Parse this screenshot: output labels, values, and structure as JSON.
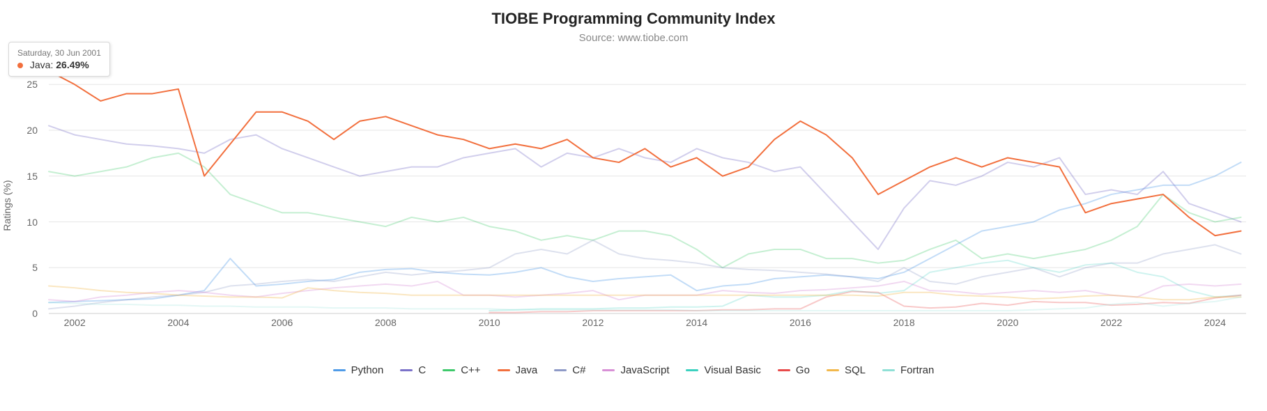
{
  "chart_data": {
    "type": "line",
    "title": "TIOBE Programming Community Index",
    "subtitle": "Source: www.tiobe.com",
    "ylabel": "Ratings (%)",
    "xlabel": "",
    "xlim": [
      2001.5,
      2024.6
    ],
    "ylim": [
      0,
      27
    ],
    "yticks": [
      0,
      5,
      10,
      15,
      20,
      25
    ],
    "xticks": [
      2002,
      2004,
      2006,
      2008,
      2010,
      2012,
      2014,
      2016,
      2018,
      2020,
      2022,
      2024
    ],
    "x": [
      2001.5,
      2002,
      2002.5,
      2003,
      2003.5,
      2004,
      2004.5,
      2005,
      2005.5,
      2006,
      2006.5,
      2007,
      2007.5,
      2008,
      2008.5,
      2009,
      2009.5,
      2010,
      2010.5,
      2011,
      2011.5,
      2012,
      2012.5,
      2013,
      2013.5,
      2014,
      2014.5,
      2015,
      2015.5,
      2016,
      2016.5,
      2017,
      2017.5,
      2018,
      2018.5,
      2019,
      2019.5,
      2020,
      2020.5,
      2021,
      2021.5,
      2022,
      2022.5,
      2023,
      2023.5,
      2024,
      2024.5
    ],
    "series": [
      {
        "name": "Python",
        "color": "#4F9BE8",
        "provisional_opacity": 0.35,
        "values": [
          1.2,
          1.3,
          1.4,
          1.5,
          1.6,
          2.0,
          2.5,
          6.0,
          3.0,
          3.2,
          3.5,
          3.7,
          4.5,
          4.8,
          4.9,
          4.5,
          4.3,
          4.2,
          4.5,
          5.0,
          4.0,
          3.5,
          3.8,
          4.0,
          4.2,
          2.5,
          3.0,
          3.2,
          3.8,
          4.0,
          4.2,
          4.0,
          3.8,
          4.5,
          6.0,
          7.5,
          9.0,
          9.5,
          10.0,
          11.3,
          12.0,
          13.0,
          13.5,
          14.0,
          14.0,
          15.0,
          16.5
        ]
      },
      {
        "name": "C",
        "color": "#7B72C9",
        "provisional_opacity": 0.35,
        "values": [
          20.5,
          19.5,
          19.0,
          18.5,
          18.3,
          18.0,
          17.5,
          19.0,
          19.5,
          18.0,
          17.0,
          16.0,
          15.0,
          15.5,
          16.0,
          16.0,
          17.0,
          17.5,
          18.0,
          16.0,
          17.5,
          17.0,
          18.0,
          17.0,
          16.5,
          18.0,
          17.0,
          16.5,
          15.5,
          16.0,
          13.0,
          10.0,
          7.0,
          11.5,
          14.5,
          14.0,
          15.0,
          16.5,
          16.0,
          17.0,
          13.0,
          13.5,
          13.0,
          15.5,
          12.0,
          11.0,
          10.0
        ]
      },
      {
        "name": "C++",
        "color": "#3EC96B",
        "provisional_opacity": 0.3,
        "values": [
          15.5,
          15.0,
          15.5,
          16.0,
          17.0,
          17.5,
          16.0,
          13.0,
          12.0,
          11.0,
          11.0,
          10.5,
          10.0,
          9.5,
          10.5,
          10.0,
          10.5,
          9.5,
          9.0,
          8.0,
          8.5,
          8.0,
          9.0,
          9.0,
          8.5,
          7.0,
          5.0,
          6.5,
          7.0,
          7.0,
          6.0,
          6.0,
          5.5,
          5.8,
          7.0,
          8.0,
          6.0,
          6.5,
          6.0,
          6.5,
          7.0,
          8.0,
          9.5,
          13.0,
          11.0,
          10.0,
          10.5
        ]
      },
      {
        "name": "Java",
        "color": "#F26F3D",
        "provisional_opacity": 1.0,
        "values": [
          26.49,
          25.0,
          23.2,
          24.0,
          24.0,
          24.5,
          15.0,
          18.5,
          22.0,
          22.0,
          21.0,
          19.0,
          21.0,
          21.5,
          20.5,
          19.5,
          19.0,
          18.0,
          18.5,
          18.0,
          19.0,
          17.0,
          16.5,
          18.0,
          16.0,
          17.0,
          15.0,
          16.0,
          19.0,
          21.0,
          19.5,
          17.0,
          13.0,
          14.5,
          16.0,
          17.0,
          16.0,
          17.0,
          16.5,
          16.0,
          11.0,
          12.0,
          12.5,
          13.0,
          10.5,
          8.5,
          9.0
        ]
      },
      {
        "name": "C#",
        "color": "#8E9AC7",
        "provisional_opacity": 0.3,
        "values": [
          0.5,
          0.8,
          1.2,
          1.5,
          1.8,
          2.0,
          2.3,
          3.0,
          3.2,
          3.5,
          3.7,
          3.5,
          4.0,
          4.5,
          4.2,
          4.5,
          4.7,
          5.0,
          6.5,
          7.0,
          6.5,
          8.0,
          6.5,
          6.0,
          5.8,
          5.5,
          5.0,
          4.8,
          4.7,
          4.5,
          4.3,
          4.0,
          3.5,
          5.0,
          3.5,
          3.2,
          4.0,
          4.5,
          5.0,
          4.0,
          5.0,
          5.5,
          5.5,
          6.5,
          7.0,
          7.5,
          6.5
        ]
      },
      {
        "name": "JavaScript",
        "color": "#D890D6",
        "provisional_opacity": 0.35,
        "values": [
          1.5,
          1.3,
          1.8,
          2.0,
          2.3,
          2.5,
          2.3,
          2.0,
          1.8,
          2.2,
          2.5,
          2.8,
          3.0,
          3.2,
          3.0,
          3.5,
          2.0,
          2.0,
          1.8,
          2.0,
          2.2,
          2.5,
          1.5,
          2.0,
          2.0,
          2.0,
          2.5,
          2.3,
          2.2,
          2.5,
          2.6,
          2.8,
          3.0,
          3.5,
          2.5,
          2.4,
          2.1,
          2.3,
          2.5,
          2.3,
          2.5,
          2.0,
          1.8,
          3.0,
          3.2,
          3.0,
          3.2
        ]
      },
      {
        "name": "Visual Basic",
        "color": "#3BD1BF",
        "provisional_opacity": 0.25,
        "values": [
          null,
          null,
          null,
          null,
          null,
          null,
          null,
          null,
          null,
          null,
          null,
          null,
          null,
          null,
          null,
          null,
          null,
          0.3,
          0.4,
          0.5,
          0.5,
          0.5,
          0.6,
          0.6,
          0.7,
          0.7,
          0.8,
          2.0,
          1.8,
          1.8,
          2.0,
          2.5,
          2.2,
          2.5,
          4.5,
          5.0,
          5.5,
          5.8,
          5.0,
          4.5,
          5.3,
          5.5,
          4.5,
          4.0,
          2.5,
          1.8,
          2.0
        ]
      },
      {
        "name": "Go",
        "color": "#E84A4A",
        "provisional_opacity": 0.3,
        "values": [
          null,
          null,
          null,
          null,
          null,
          null,
          null,
          null,
          null,
          null,
          null,
          null,
          null,
          null,
          null,
          null,
          null,
          0.1,
          0.1,
          0.2,
          0.2,
          0.3,
          0.3,
          0.3,
          0.3,
          0.3,
          0.4,
          0.4,
          0.5,
          0.5,
          1.8,
          2.4,
          2.3,
          0.8,
          0.6,
          0.7,
          1.1,
          0.9,
          1.3,
          1.2,
          1.2,
          0.9,
          1.0,
          1.2,
          1.1,
          1.7,
          2.0
        ]
      },
      {
        "name": "SQL",
        "color": "#F2B84B",
        "provisional_opacity": 0.35,
        "values": [
          3.0,
          2.8,
          2.5,
          2.3,
          2.2,
          2.0,
          1.9,
          1.8,
          1.8,
          1.7,
          2.8,
          2.5,
          2.3,
          2.2,
          2.0,
          2.0,
          2.0,
          2.0,
          2.0,
          2.0,
          2.0,
          2.0,
          2.0,
          2.0,
          2.0,
          2.0,
          2.0,
          2.0,
          2.0,
          2.0,
          2.0,
          2.0,
          1.9,
          2.3,
          2.3,
          2.0,
          1.9,
          1.8,
          1.6,
          1.7,
          1.9,
          2.0,
          1.8,
          1.5,
          1.5,
          1.8,
          1.8
        ]
      },
      {
        "name": "Fortran",
        "color": "#8FE0D6",
        "provisional_opacity": 0.25,
        "values": [
          1.2,
          1.1,
          1.0,
          1.0,
          0.9,
          0.9,
          0.8,
          0.8,
          0.7,
          0.7,
          0.7,
          0.6,
          0.6,
          0.6,
          0.5,
          0.5,
          0.5,
          0.5,
          0.4,
          0.4,
          0.4,
          0.4,
          0.4,
          0.4,
          0.4,
          0.3,
          0.3,
          0.3,
          0.3,
          0.3,
          0.3,
          0.3,
          0.3,
          0.3,
          0.3,
          0.3,
          0.3,
          0.3,
          0.4,
          0.5,
          0.6,
          1.0,
          1.2,
          0.8,
          1.1,
          1.3,
          1.8
        ]
      }
    ],
    "highlighted_series": "Java",
    "hover": {
      "x_index": 0,
      "series": "Java",
      "date_label": "Saturday, 30 Jun 2001",
      "value_label": "26.49%"
    }
  }
}
